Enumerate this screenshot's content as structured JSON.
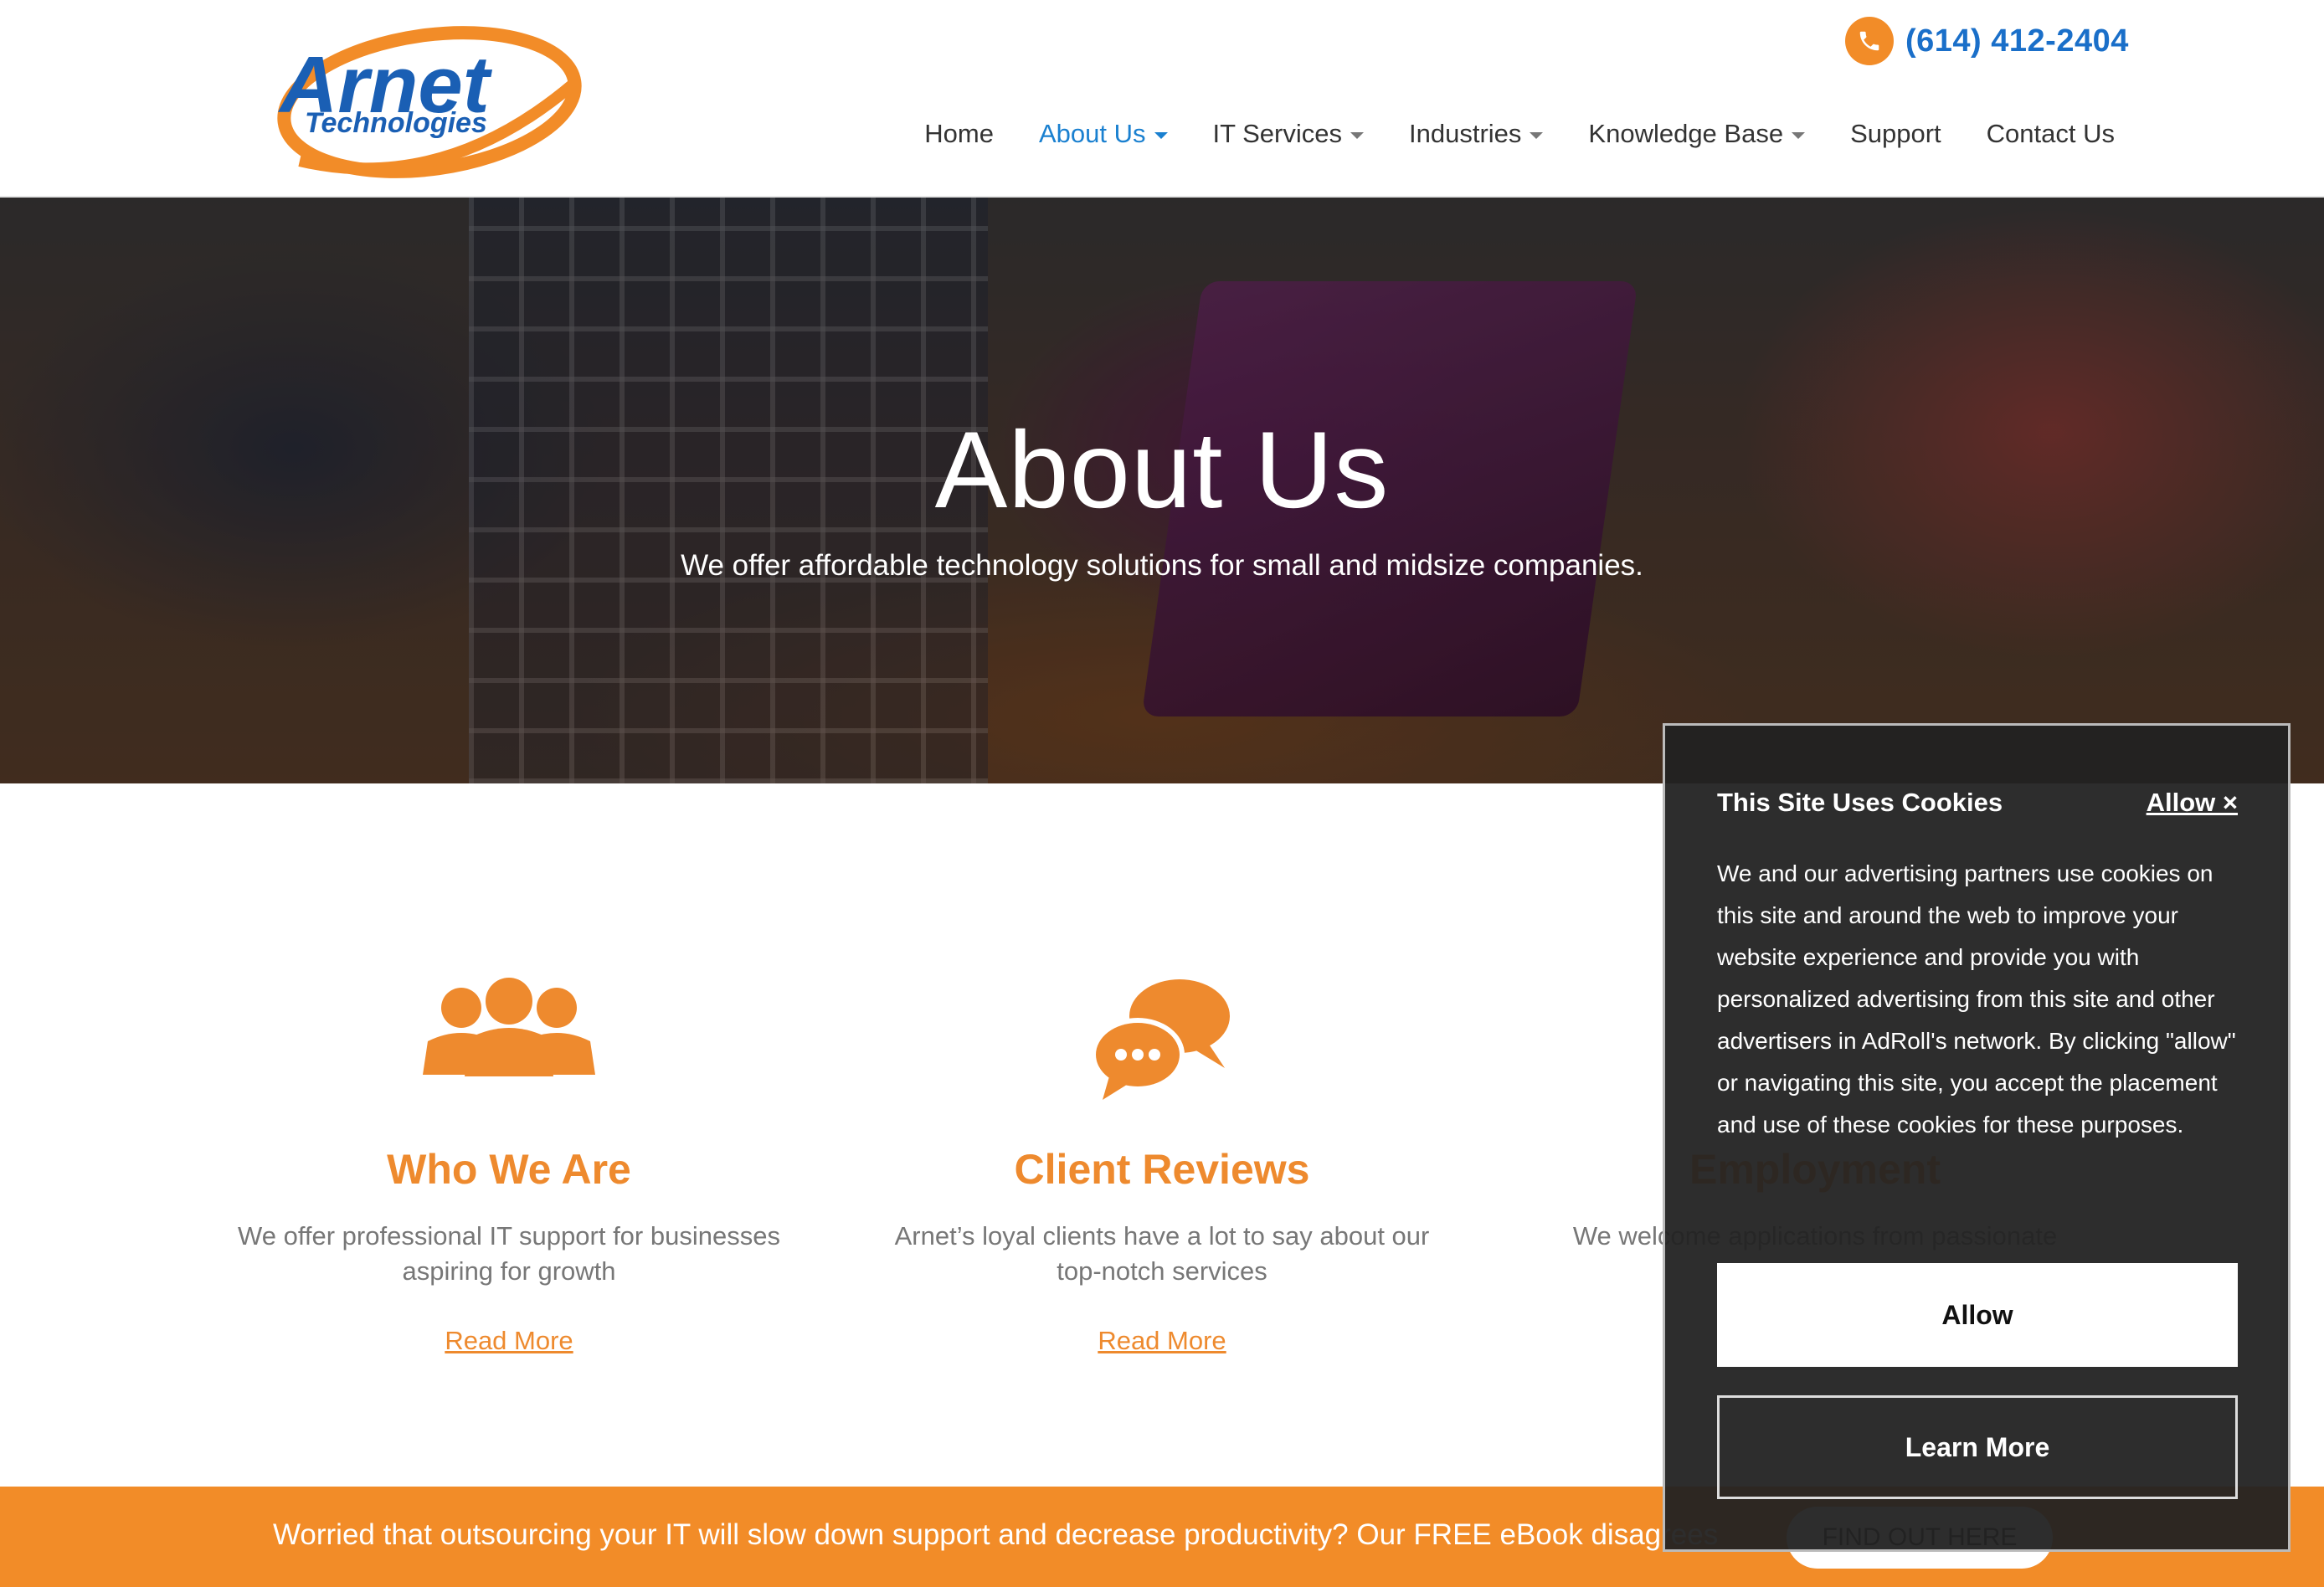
{
  "header": {
    "logo_text_1": "Arnet",
    "logo_text_2": "Technologies",
    "phone_icon": "phone-icon",
    "phone": "(614) 412-2404",
    "nav": [
      {
        "label": "Home",
        "dropdown": false,
        "active": false
      },
      {
        "label": "About Us",
        "dropdown": true,
        "active": true
      },
      {
        "label": "IT Services",
        "dropdown": true,
        "active": false
      },
      {
        "label": "Industries",
        "dropdown": true,
        "active": false
      },
      {
        "label": "Knowledge Base",
        "dropdown": true,
        "active": false
      },
      {
        "label": "Support",
        "dropdown": false,
        "active": false
      },
      {
        "label": "Contact Us",
        "dropdown": false,
        "active": false
      }
    ]
  },
  "hero": {
    "title": "About Us",
    "subtitle": "We offer affordable technology solutions for small and midsize companies."
  },
  "features": [
    {
      "icon": "people-group-icon",
      "title": "Who We Are",
      "desc": "We offer professional IT support for businesses aspiring for growth",
      "link": "Read More"
    },
    {
      "icon": "chat-bubbles-icon",
      "title": "Client Reviews",
      "desc": "Arnet’s loyal clients have a lot to say about our top-notch services",
      "link": "Read More"
    },
    {
      "icon": "briefcase-icon",
      "title": "Employment",
      "desc": "We welcome applications from passionate",
      "link": ""
    }
  ],
  "banner": {
    "text": "Worried that outsourcing your IT will slow down support and decrease productivity? Our FREE eBook disagrees",
    "button": "FIND OUT HERE"
  },
  "cookie": {
    "title": "This Site Uses Cookies",
    "allow_link": "Allow ×",
    "body": "We and our advertising partners use cookies on this site and around the web to improve your website experience and provide you with personalized advertising from this site and other advertisers in AdRoll's network. By clicking \"allow\" or navigating this site, you accept the placement and use of these cookies for these purposes.",
    "allow_button": "Allow",
    "learn_button": "Learn More"
  },
  "colors": {
    "accent_orange": "#f28c28",
    "link_blue": "#1a80d0",
    "modal_bg": "#222222"
  }
}
